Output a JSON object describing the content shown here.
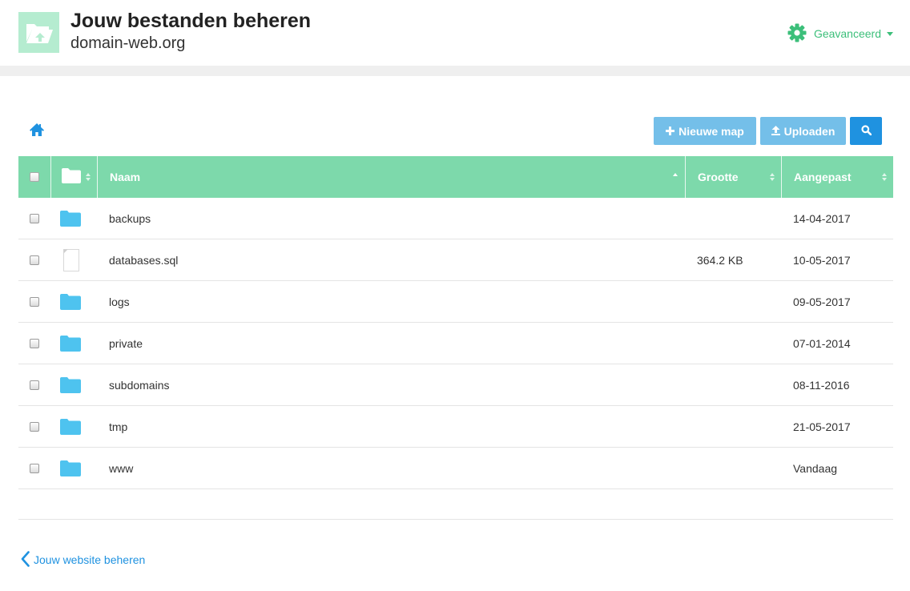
{
  "header": {
    "title": "Jouw bestanden beheren",
    "subtitle": "domain-web.org",
    "advanced_label": "Geavanceerd",
    "logo_icon": "folder-upload-icon",
    "settings_icon": "gear-icon"
  },
  "toolbar": {
    "home_icon": "home-icon",
    "new_folder_label": "Nieuwe map",
    "upload_label": "Uploaden",
    "search_icon": "search-icon"
  },
  "table": {
    "columns": {
      "name": "Naam",
      "size": "Grootte",
      "modified": "Aangepast"
    },
    "rows": [
      {
        "type": "folder",
        "name": "backups",
        "size": "",
        "modified": "14-04-2017"
      },
      {
        "type": "file",
        "name": "databases.sql",
        "size": "364.2 KB",
        "modified": "10-05-2017"
      },
      {
        "type": "folder",
        "name": "logs",
        "size": "",
        "modified": "09-05-2017"
      },
      {
        "type": "folder",
        "name": "private",
        "size": "",
        "modified": "07-01-2014"
      },
      {
        "type": "folder",
        "name": "subdomains",
        "size": "",
        "modified": "08-11-2016"
      },
      {
        "type": "folder",
        "name": "tmp",
        "size": "",
        "modified": "21-05-2017"
      },
      {
        "type": "folder",
        "name": "www",
        "size": "",
        "modified": "Vandaag"
      }
    ]
  },
  "footer": {
    "back_label": "Jouw website beheren",
    "back_icon": "chevron-left-icon"
  },
  "colors": {
    "accent_green": "#3cbf7a",
    "table_header": "#7dd9ab",
    "primary_blue": "#1f92e0",
    "button_light_blue": "#74bfe9",
    "folder_icon": "#4ec3ef"
  }
}
